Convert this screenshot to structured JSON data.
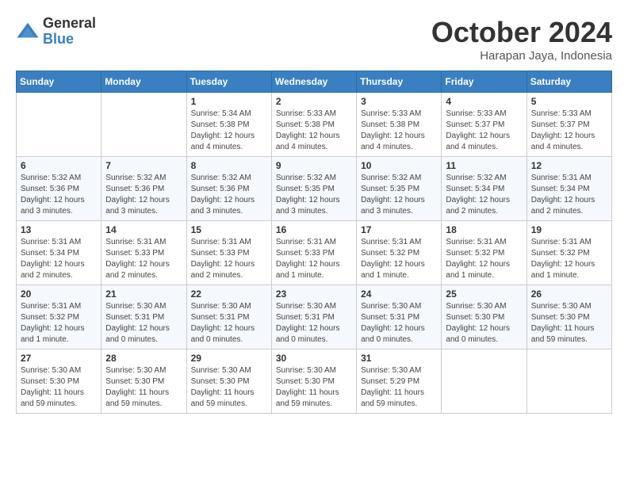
{
  "logo": {
    "general": "General",
    "blue": "Blue"
  },
  "title": "October 2024",
  "location": "Harapan Jaya, Indonesia",
  "weekdays": [
    "Sunday",
    "Monday",
    "Tuesday",
    "Wednesday",
    "Thursday",
    "Friday",
    "Saturday"
  ],
  "weeks": [
    [
      {
        "day": "",
        "info": ""
      },
      {
        "day": "",
        "info": ""
      },
      {
        "day": "1",
        "info": "Sunrise: 5:34 AM\nSunset: 5:38 PM\nDaylight: 12 hours and 4 minutes."
      },
      {
        "day": "2",
        "info": "Sunrise: 5:33 AM\nSunset: 5:38 PM\nDaylight: 12 hours and 4 minutes."
      },
      {
        "day": "3",
        "info": "Sunrise: 5:33 AM\nSunset: 5:38 PM\nDaylight: 12 hours and 4 minutes."
      },
      {
        "day": "4",
        "info": "Sunrise: 5:33 AM\nSunset: 5:37 PM\nDaylight: 12 hours and 4 minutes."
      },
      {
        "day": "5",
        "info": "Sunrise: 5:33 AM\nSunset: 5:37 PM\nDaylight: 12 hours and 4 minutes."
      }
    ],
    [
      {
        "day": "6",
        "info": "Sunrise: 5:32 AM\nSunset: 5:36 PM\nDaylight: 12 hours and 3 minutes."
      },
      {
        "day": "7",
        "info": "Sunrise: 5:32 AM\nSunset: 5:36 PM\nDaylight: 12 hours and 3 minutes."
      },
      {
        "day": "8",
        "info": "Sunrise: 5:32 AM\nSunset: 5:36 PM\nDaylight: 12 hours and 3 minutes."
      },
      {
        "day": "9",
        "info": "Sunrise: 5:32 AM\nSunset: 5:35 PM\nDaylight: 12 hours and 3 minutes."
      },
      {
        "day": "10",
        "info": "Sunrise: 5:32 AM\nSunset: 5:35 PM\nDaylight: 12 hours and 3 minutes."
      },
      {
        "day": "11",
        "info": "Sunrise: 5:32 AM\nSunset: 5:34 PM\nDaylight: 12 hours and 2 minutes."
      },
      {
        "day": "12",
        "info": "Sunrise: 5:31 AM\nSunset: 5:34 PM\nDaylight: 12 hours and 2 minutes."
      }
    ],
    [
      {
        "day": "13",
        "info": "Sunrise: 5:31 AM\nSunset: 5:34 PM\nDaylight: 12 hours and 2 minutes."
      },
      {
        "day": "14",
        "info": "Sunrise: 5:31 AM\nSunset: 5:33 PM\nDaylight: 12 hours and 2 minutes."
      },
      {
        "day": "15",
        "info": "Sunrise: 5:31 AM\nSunset: 5:33 PM\nDaylight: 12 hours and 2 minutes."
      },
      {
        "day": "16",
        "info": "Sunrise: 5:31 AM\nSunset: 5:33 PM\nDaylight: 12 hours and 1 minute."
      },
      {
        "day": "17",
        "info": "Sunrise: 5:31 AM\nSunset: 5:32 PM\nDaylight: 12 hours and 1 minute."
      },
      {
        "day": "18",
        "info": "Sunrise: 5:31 AM\nSunset: 5:32 PM\nDaylight: 12 hours and 1 minute."
      },
      {
        "day": "19",
        "info": "Sunrise: 5:31 AM\nSunset: 5:32 PM\nDaylight: 12 hours and 1 minute."
      }
    ],
    [
      {
        "day": "20",
        "info": "Sunrise: 5:31 AM\nSunset: 5:32 PM\nDaylight: 12 hours and 1 minute."
      },
      {
        "day": "21",
        "info": "Sunrise: 5:30 AM\nSunset: 5:31 PM\nDaylight: 12 hours and 0 minutes."
      },
      {
        "day": "22",
        "info": "Sunrise: 5:30 AM\nSunset: 5:31 PM\nDaylight: 12 hours and 0 minutes."
      },
      {
        "day": "23",
        "info": "Sunrise: 5:30 AM\nSunset: 5:31 PM\nDaylight: 12 hours and 0 minutes."
      },
      {
        "day": "24",
        "info": "Sunrise: 5:30 AM\nSunset: 5:31 PM\nDaylight: 12 hours and 0 minutes."
      },
      {
        "day": "25",
        "info": "Sunrise: 5:30 AM\nSunset: 5:30 PM\nDaylight: 12 hours and 0 minutes."
      },
      {
        "day": "26",
        "info": "Sunrise: 5:30 AM\nSunset: 5:30 PM\nDaylight: 11 hours and 59 minutes."
      }
    ],
    [
      {
        "day": "27",
        "info": "Sunrise: 5:30 AM\nSunset: 5:30 PM\nDaylight: 11 hours and 59 minutes."
      },
      {
        "day": "28",
        "info": "Sunrise: 5:30 AM\nSunset: 5:30 PM\nDaylight: 11 hours and 59 minutes."
      },
      {
        "day": "29",
        "info": "Sunrise: 5:30 AM\nSunset: 5:30 PM\nDaylight: 11 hours and 59 minutes."
      },
      {
        "day": "30",
        "info": "Sunrise: 5:30 AM\nSunset: 5:30 PM\nDaylight: 11 hours and 59 minutes."
      },
      {
        "day": "31",
        "info": "Sunrise: 5:30 AM\nSunset: 5:29 PM\nDaylight: 11 hours and 59 minutes."
      },
      {
        "day": "",
        "info": ""
      },
      {
        "day": "",
        "info": ""
      }
    ]
  ]
}
